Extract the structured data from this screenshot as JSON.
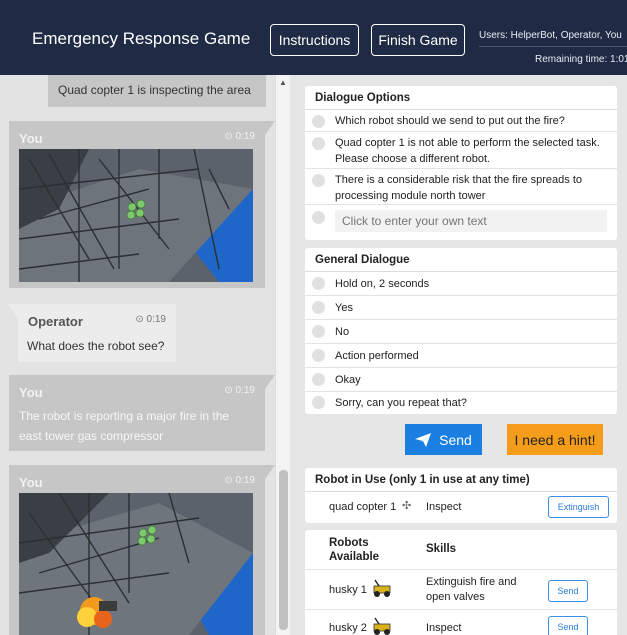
{
  "header": {
    "title": "Emergency Response Game",
    "instructions_label": "Instructions",
    "finish_label": "Finish Game",
    "users": "Users: HelperBot, Operator, You",
    "remaining": "Remaining time: 1:01"
  },
  "chat": {
    "messages": [
      {
        "text": "Quad copter 1 is inspecting the area"
      },
      {
        "sender": "You",
        "time": "0:19"
      },
      {
        "sender": "Operator",
        "time": "0:19",
        "text": "What does the robot see?"
      },
      {
        "sender": "You",
        "time": "0:19",
        "text": "The robot is reporting a major fire in the east tower gas compressor"
      },
      {
        "sender": "You",
        "time": "0:19"
      }
    ]
  },
  "dialogue_options": {
    "title": "Dialogue Options",
    "options": [
      "Which robot should we send to put out the fire?",
      "Quad copter 1 is not able to perform the selected task. Please choose a different robot.",
      "There is a considerable risk that the fire spreads to processing module north tower"
    ],
    "own_text_placeholder": "Click to enter your own text"
  },
  "general_dialogue": {
    "title": "General Dialogue",
    "options": [
      "Hold on, 2 seconds",
      "Yes",
      "No",
      "Action performed",
      "Okay",
      "Sorry, can you repeat that?"
    ]
  },
  "actions": {
    "send_label": "Send",
    "hint_label": "I need a hint!"
  },
  "robot_in_use": {
    "title": "Robot in Use (only 1 in use at any time)",
    "name": "quad copter 1",
    "skill": "Inspect",
    "button": "Extinguish"
  },
  "robots_available": {
    "header_robots": "Robots Available",
    "header_skills": "Skills",
    "rows": [
      {
        "name": "husky 1",
        "skills": "Extinguish fire and open valves",
        "button": "Send"
      },
      {
        "name": "husky 2",
        "skills": "Inspect",
        "button": "Send"
      }
    ]
  },
  "colors": {
    "header_bg": "#1f2a44",
    "send_bg": "#1a7fe0",
    "hint_bg": "#f59d1a",
    "bubble_you": "#c6c6c6",
    "bubble_operator": "#ececec"
  }
}
